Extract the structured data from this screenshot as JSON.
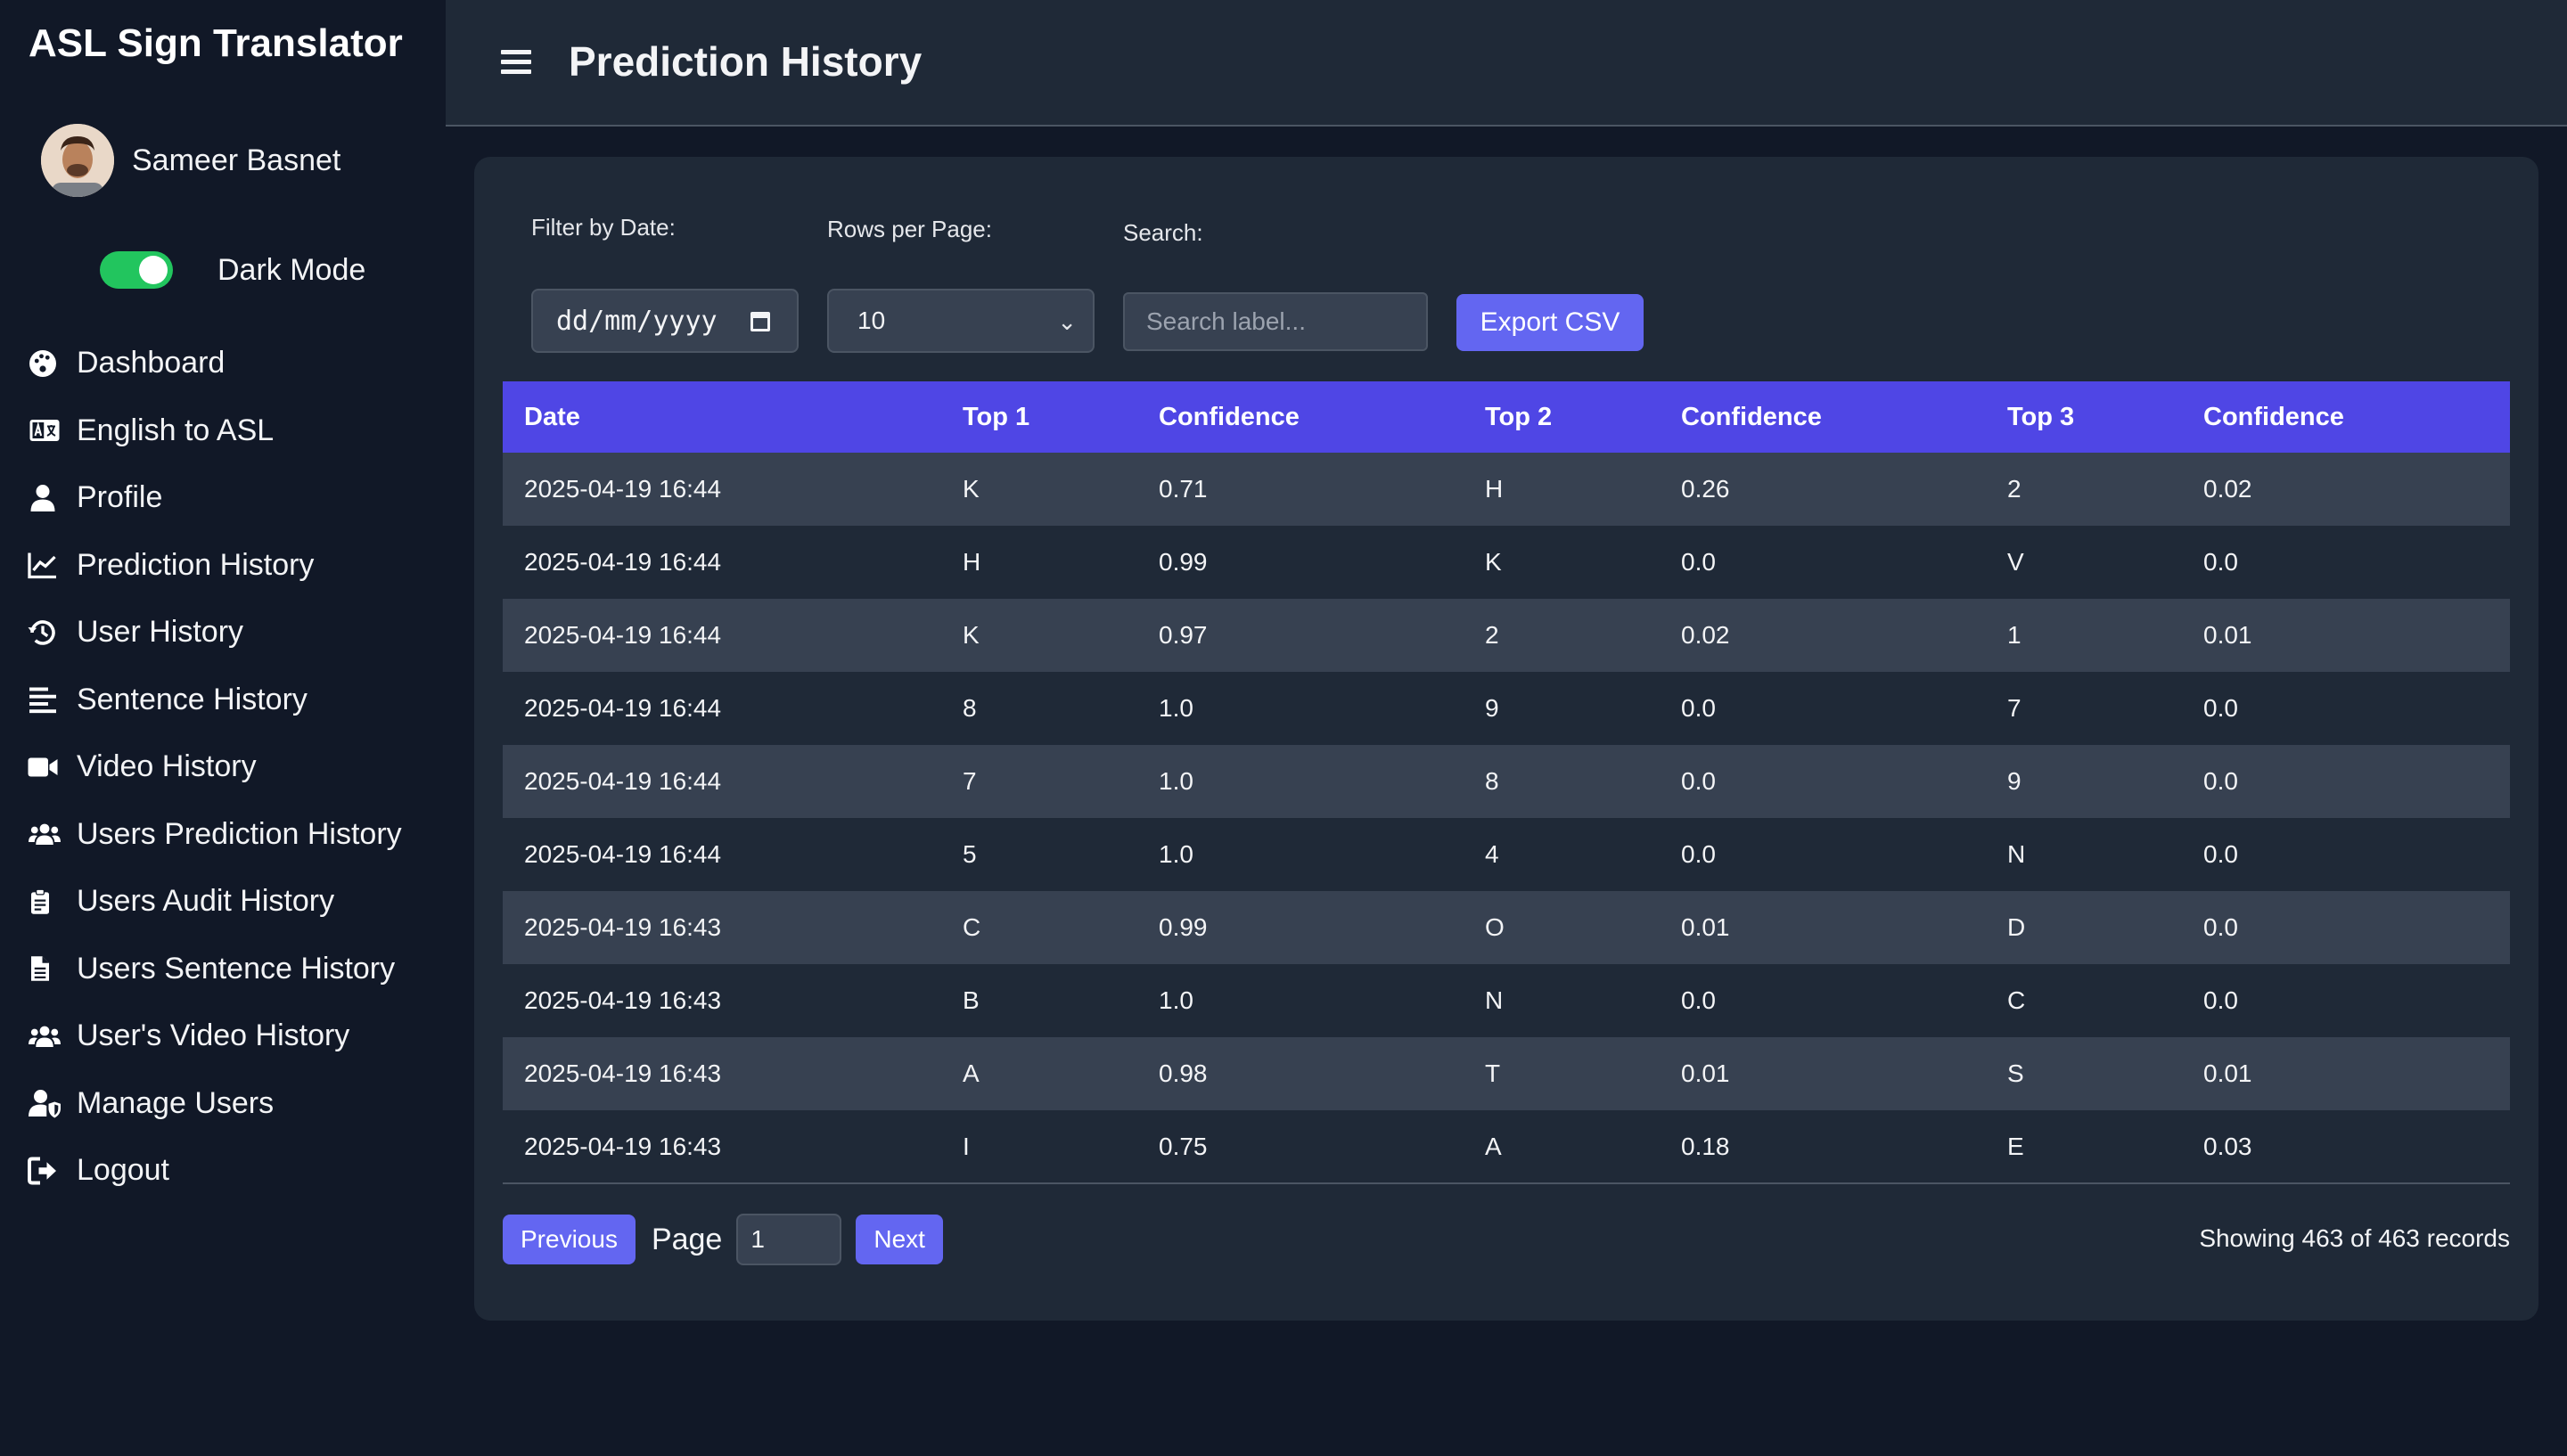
{
  "app": {
    "title": "ASL Sign Translator"
  },
  "user": {
    "name": "Sameer Basnet"
  },
  "theme": {
    "toggle_label": "Dark Mode",
    "enabled": true
  },
  "sidebar": {
    "items": [
      {
        "label": "Dashboard",
        "icon": "palette-icon"
      },
      {
        "label": "English to ASL",
        "icon": "language-icon"
      },
      {
        "label": "Profile",
        "icon": "user-icon"
      },
      {
        "label": "Prediction History",
        "icon": "line-chart-icon"
      },
      {
        "label": "User History",
        "icon": "history-icon"
      },
      {
        "label": "Sentence History",
        "icon": "align-left-icon"
      },
      {
        "label": "Video History",
        "icon": "video-icon"
      },
      {
        "label": "Users Prediction History",
        "icon": "users-icon"
      },
      {
        "label": "Users Audit History",
        "icon": "clipboard-icon"
      },
      {
        "label": "Users Sentence History",
        "icon": "file-icon"
      },
      {
        "label": "User's Video History",
        "icon": "users-icon"
      },
      {
        "label": "Manage Users",
        "icon": "user-shield-icon"
      },
      {
        "label": "Logout",
        "icon": "logout-icon"
      }
    ]
  },
  "header": {
    "title": "Prediction History"
  },
  "filters": {
    "date_label": "Filter by Date:",
    "date_placeholder": "dd/mm/yyyy",
    "rows_label": "Rows per Page:",
    "rows_value": "10",
    "search_label": "Search:",
    "search_placeholder": "Search label...",
    "export_label": "Export CSV"
  },
  "table": {
    "headers": [
      "Date",
      "Top 1",
      "Confidence",
      "Top 2",
      "Confidence",
      "Top 3",
      "Confidence"
    ],
    "rows": [
      [
        "2025-04-19 16:44",
        "K",
        "0.71",
        "H",
        "0.26",
        "2",
        "0.02"
      ],
      [
        "2025-04-19 16:44",
        "H",
        "0.99",
        "K",
        "0.0",
        "V",
        "0.0"
      ],
      [
        "2025-04-19 16:44",
        "K",
        "0.97",
        "2",
        "0.02",
        "1",
        "0.01"
      ],
      [
        "2025-04-19 16:44",
        "8",
        "1.0",
        "9",
        "0.0",
        "7",
        "0.0"
      ],
      [
        "2025-04-19 16:44",
        "7",
        "1.0",
        "8",
        "0.0",
        "9",
        "0.0"
      ],
      [
        "2025-04-19 16:44",
        "5",
        "1.0",
        "4",
        "0.0",
        "N",
        "0.0"
      ],
      [
        "2025-04-19 16:43",
        "C",
        "0.99",
        "O",
        "0.01",
        "D",
        "0.0"
      ],
      [
        "2025-04-19 16:43",
        "B",
        "1.0",
        "N",
        "0.0",
        "C",
        "0.0"
      ],
      [
        "2025-04-19 16:43",
        "A",
        "0.98",
        "T",
        "0.01",
        "S",
        "0.01"
      ],
      [
        "2025-04-19 16:43",
        "I",
        "0.75",
        "A",
        "0.18",
        "E",
        "0.03"
      ]
    ]
  },
  "pagination": {
    "prev_label": "Previous",
    "page_label": "Page",
    "page_value": "1",
    "next_label": "Next",
    "records_text": "Showing 463 of 463 records"
  },
  "colors": {
    "background": "#111827",
    "panel": "#1f2937",
    "accent": "#6366f1",
    "table_header": "#4f46e5",
    "toggle_on": "#22c55e"
  }
}
